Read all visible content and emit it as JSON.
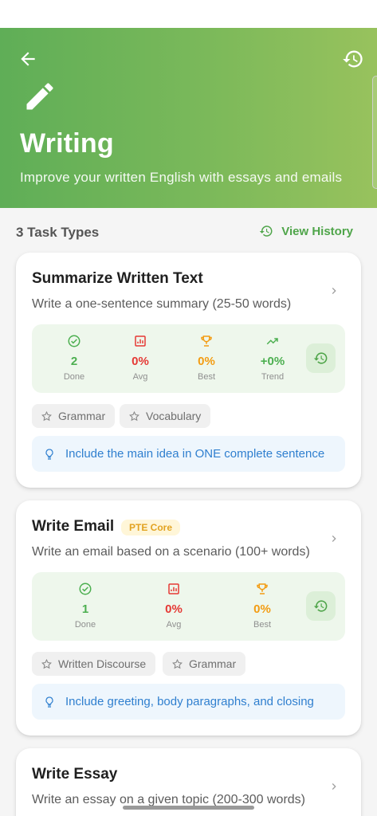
{
  "header": {
    "title": "Writing",
    "subtitle": "Improve your written English with essays and emails"
  },
  "toolbar": {
    "task_count": "3 Task Types",
    "view_history": "View History"
  },
  "cards": [
    {
      "title": "Summarize Written Text",
      "badge": "",
      "description": "Write a one-sentence summary (25-50 words)",
      "stats": [
        {
          "icon": "check-circle-icon",
          "value": "2",
          "label": "Done",
          "color": "#4caf50"
        },
        {
          "icon": "bar-chart-icon",
          "value": "0%",
          "label": "Avg",
          "color": "#e53935"
        },
        {
          "icon": "trophy-icon",
          "value": "0%",
          "label": "Best",
          "color": "#f39c12"
        },
        {
          "icon": "trending-up-icon",
          "value": "+0%",
          "label": "Trend",
          "color": "#4caf50"
        }
      ],
      "tags": [
        "Grammar",
        "Vocabulary"
      ],
      "tip": "Include the main idea in ONE complete sentence"
    },
    {
      "title": "Write Email",
      "badge": "PTE Core",
      "description": "Write an email based on a scenario (100+ words)",
      "stats": [
        {
          "icon": "check-circle-icon",
          "value": "1",
          "label": "Done",
          "color": "#4caf50"
        },
        {
          "icon": "bar-chart-icon",
          "value": "0%",
          "label": "Avg",
          "color": "#e53935"
        },
        {
          "icon": "trophy-icon",
          "value": "0%",
          "label": "Best",
          "color": "#f39c12"
        }
      ],
      "tags": [
        "Written Discourse",
        "Grammar"
      ],
      "tip": "Include greeting, body paragraphs, and closing"
    },
    {
      "title": "Write Essay",
      "badge": "",
      "description": "Write an essay on a given topic (200-300 words)"
    }
  ],
  "colors": {
    "accent": "#4fa54a",
    "header_gradient_start": "#5fae57",
    "header_gradient_end": "#98c25d",
    "tip_text": "#2f7fcf"
  }
}
